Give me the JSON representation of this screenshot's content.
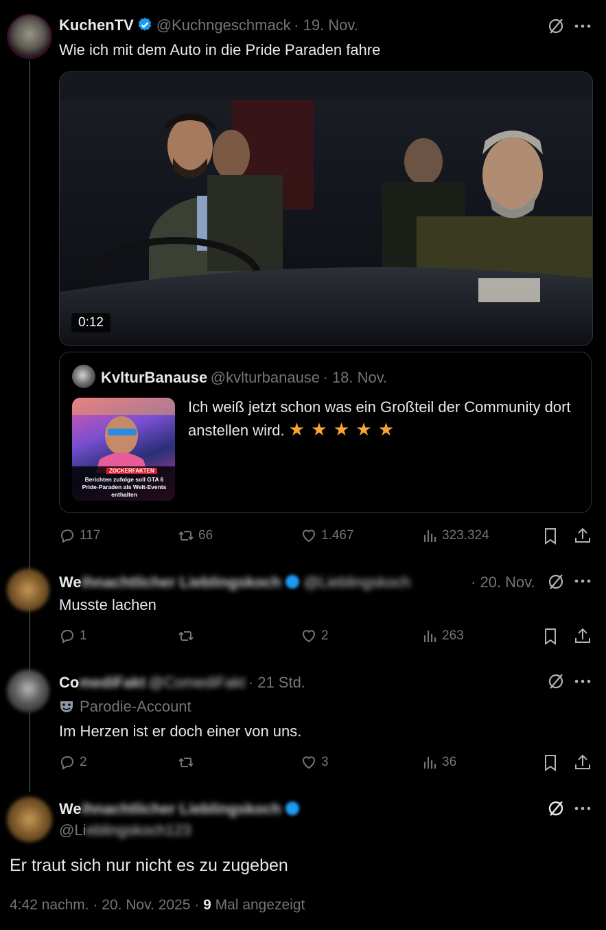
{
  "main_post": {
    "display_name": "KuchenTV",
    "handle": "@Kuchngeschmack",
    "date": "· 19. Nov.",
    "text": "Wie ich mit dem Auto in die Pride Paraden fahre",
    "video_duration": "0:12",
    "quote": {
      "display_name": "KvlturBanause",
      "handle": "@kvlturbanause",
      "date": "· 18. Nov.",
      "text": "Ich weiß jetzt schon was ein Großteil der Community dort anstellen wird.",
      "stars": "★ ★ ★ ★ ★",
      "thumb_banner": "ZOCKERFAKTEN",
      "thumb_caption": "Berichten zufolge soll GTA 6 Pride-Paraden als Welt-Events enthalten"
    },
    "stats": {
      "replies": "117",
      "reposts": "66",
      "likes": "1.467",
      "views": "323.324"
    }
  },
  "reply1": {
    "display_name_visible": "We",
    "display_name_blurred": "ihnachtlicher Lieblingskoch",
    "handle_blurred": "@Lieblingskoch",
    "date": "· 20. Nov.",
    "text": "Musste lachen",
    "stats": {
      "replies": "1",
      "reposts": "",
      "likes": "2",
      "views": "263"
    }
  },
  "reply2": {
    "display_name_visible": "Co",
    "display_name_blurred": "mediFakt",
    "handle_blurred": "@ComediFakt",
    "date": "· 21 Std.",
    "badge": "Parodie-Account",
    "text": "Im Herzen ist er doch einer von uns.",
    "stats": {
      "replies": "2",
      "reposts": "",
      "likes": "3",
      "views": "36"
    }
  },
  "focus_post": {
    "display_name_visible": "We",
    "display_name_blurred": "ihnachtlicher Lieblingskoch",
    "handle_visible": "@Li",
    "handle_blurred": "eblingskoch123",
    "text": "Er traut sich nur nicht es zu zugeben",
    "time": "4:42 nachm. · 20. Nov. 2025 ·",
    "views_count": "9",
    "views_label": "Mal angezeigt"
  },
  "colors": {
    "verified": "#1d9bf0",
    "star": "#f7a534",
    "muted": "#71767b",
    "line": "#333639"
  }
}
